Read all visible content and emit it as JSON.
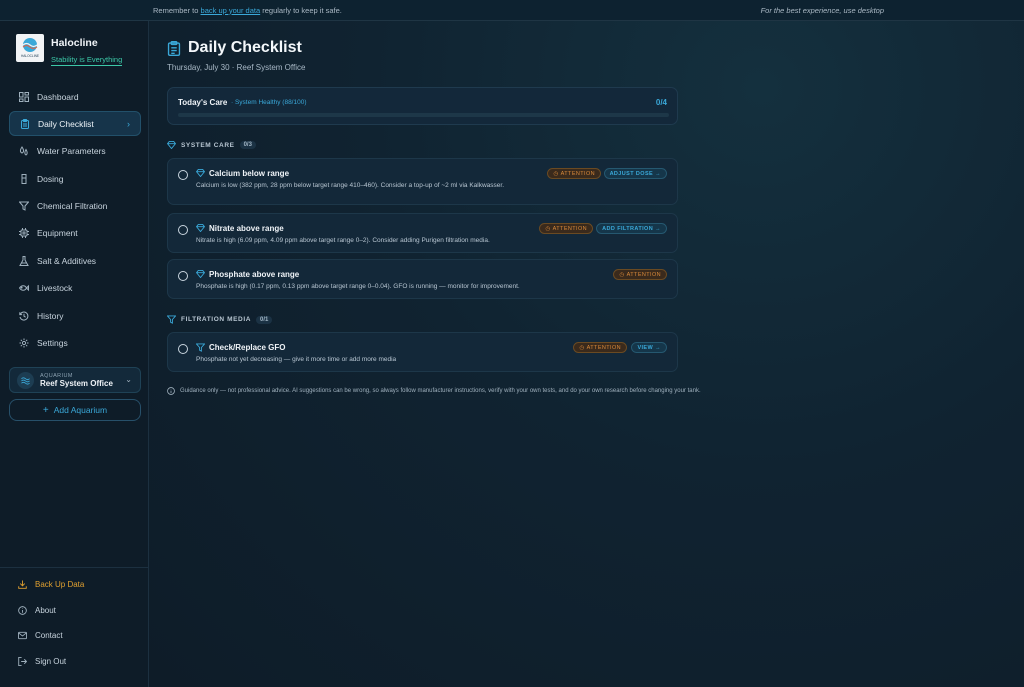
{
  "banner": {
    "prefix": "Remember to",
    "link": "back up your data",
    "suffix": "regularly to keep it safe.",
    "right": "For the best experience, use desktop"
  },
  "brand": {
    "name": "Halocline",
    "tagline": "Stability is Everything",
    "logo_text": "HALOCLINE"
  },
  "nav": [
    {
      "label": "Dashboard",
      "icon": "dashboard-icon"
    },
    {
      "label": "Daily Checklist",
      "icon": "clipboard-icon",
      "active": true
    },
    {
      "label": "Water Parameters",
      "icon": "droplets-icon"
    },
    {
      "label": "Dosing",
      "icon": "dosing-icon"
    },
    {
      "label": "Chemical Filtration",
      "icon": "filter-icon"
    },
    {
      "label": "Equipment",
      "icon": "chip-icon"
    },
    {
      "label": "Salt & Additives",
      "icon": "flask-icon"
    },
    {
      "label": "Livestock",
      "icon": "fish-icon"
    },
    {
      "label": "History",
      "icon": "history-icon"
    },
    {
      "label": "Settings",
      "icon": "gear-icon"
    }
  ],
  "aquarium": {
    "caption": "AQUARIUM",
    "name": "Reef System Office"
  },
  "add_aquarium": "Add Aquarium",
  "bottom_nav": [
    {
      "label": "Back Up Data",
      "icon": "download-icon"
    },
    {
      "label": "About",
      "icon": "info-icon"
    },
    {
      "label": "Contact",
      "icon": "mail-icon"
    },
    {
      "label": "Sign Out",
      "icon": "sign-out-icon"
    }
  ],
  "page": {
    "title": "Daily Checklist",
    "subtitle": "Thursday, July 30 · Reef System Office"
  },
  "care": {
    "title": "Today's Care",
    "health": "· System Healthy (88/100)",
    "count": "0/4",
    "progress": 0
  },
  "sections": {
    "system_care": {
      "label": "SYSTEM CARE",
      "count": "0/3"
    },
    "filtration": {
      "label": "FILTRATION MEDIA",
      "count": "0/1"
    }
  },
  "tasks": [
    {
      "title": "Calcium below range",
      "desc": "Calcium is low (382 ppm, 28 ppm below target range 410–460). Consider a top-up of ~2 ml via Kalkwasser.",
      "badge": "ATTENTION",
      "action": "ADJUST DOSE"
    },
    {
      "title": "Nitrate above range",
      "desc": "Nitrate is high (6.09 ppm, 4.09 ppm above target range 0–2). Consider adding Purigen filtration media.",
      "badge": "ATTENTION",
      "action": "ADD FILTRATION"
    },
    {
      "title": "Phosphate above range",
      "desc": "Phosphate is high (0.17 ppm, 0.13 ppm above target range 0–0.04). GFO is running — monitor for improvement.",
      "badge": "ATTENTION",
      "action": ""
    },
    {
      "title": "Check/Replace GFO",
      "desc": "Phosphate not yet decreasing — give it more time or add more media",
      "badge": "ATTENTION",
      "action": "VIEW"
    }
  ],
  "disclaimer": "Guidance only — not professional advice. AI suggestions can be wrong, so always follow manufacturer instructions, verify with your own tests, and do your own research before changing your tank.",
  "colors": {
    "accent": "#3aa8d8",
    "attention": "#d8893a",
    "backup": "#e0a030",
    "tagline": "#3cc8a8"
  }
}
